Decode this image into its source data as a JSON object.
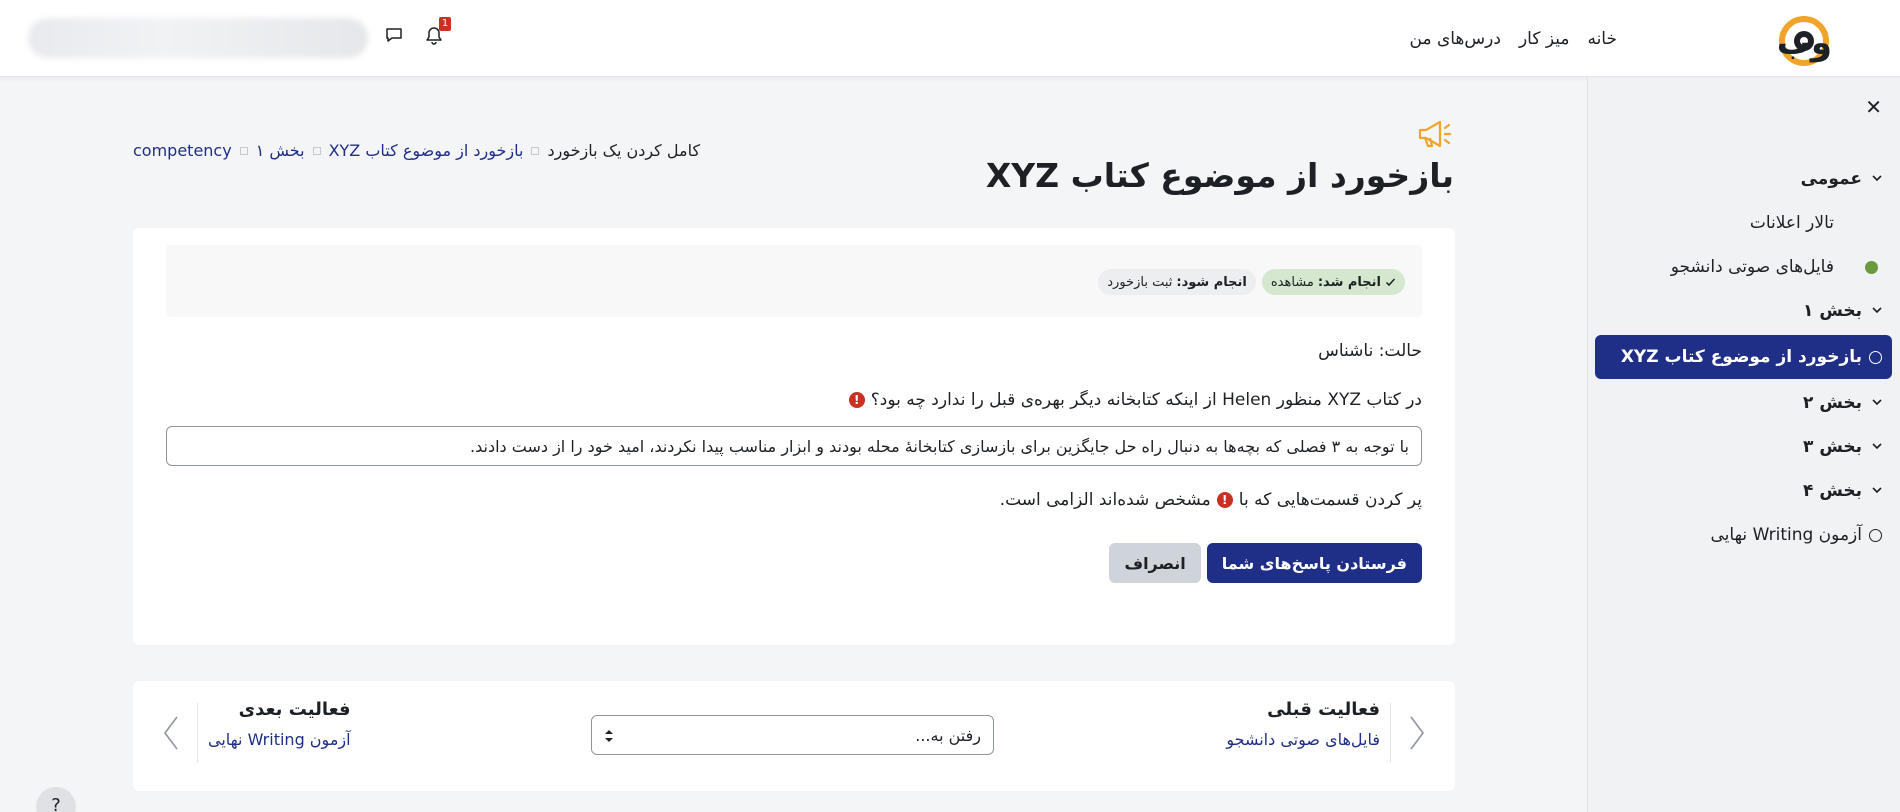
{
  "navbar": {
    "logo_text": "وب",
    "links": [
      "خانه",
      "میز کار",
      "درس‌های من"
    ],
    "notification_count": "1"
  },
  "drawer": {
    "close_glyph": "✕",
    "course_index": [
      {
        "type": "section",
        "label": "عمومی"
      },
      {
        "type": "item",
        "label": "تالار اعلانات",
        "state": "none"
      },
      {
        "type": "item",
        "label": "فایل‌های صوتی دانشجو",
        "state": "done"
      },
      {
        "type": "section",
        "label": "بخش ۱"
      },
      {
        "type": "item",
        "label": "بازخورد از موضوع کتاب XYZ",
        "state": "active"
      },
      {
        "type": "section",
        "label": "بخش ۲"
      },
      {
        "type": "section",
        "label": "بخش ۳"
      },
      {
        "type": "section",
        "label": "بخش ۴"
      },
      {
        "type": "item",
        "label": "آزمون Writing نهایی",
        "state": "todo"
      }
    ]
  },
  "header": {
    "title": "بازخورد از موضوع کتاب XYZ",
    "icon": "megaphone-icon",
    "breadcrumb": [
      "competency",
      "بخش ۱",
      "بازخورد از موضوع کتاب XYZ",
      "کامل کردن یک بازخورد"
    ]
  },
  "completion": {
    "done_label": "انجام شد:",
    "done_value": "مشاهده",
    "todo_label": "انجام شود:",
    "todo_value": "ثبت بازخورد"
  },
  "form": {
    "status": "حالت: ناشناس",
    "question": "در کتاب XYZ منظور Helen از اینکه کتابخانه دیگر بهره‌ی قبل را ندارد چه بود؟",
    "answer": "با توجه به ۳ فصلی که بچه‌ها به دنبال راه حل جایگزین برای بازسازی کتابخانهٔ محله بودند و ابزار مناسب پیدا نکردند، امید خود را از دست دادند.",
    "required_before": "پر کردن قسمت‌هایی که با",
    "required_after": "مشخص شده‌اند الزامی است.",
    "submit_label": "فرستادن پاسخ‌های شما",
    "cancel_label": "انصراف"
  },
  "activity_nav": {
    "prev_heading": "فعالیت قبلی",
    "prev_link": "فایل‌های صوتی دانشجو",
    "jump_placeholder": "رفتن به...",
    "next_heading": "فعالیت بعدی",
    "next_link": "آزمون Writing نهایی"
  },
  "colors": {
    "primary": "#1f2f88",
    "accent_orange": "#f0a52a",
    "error_red": "#ca3120",
    "success_green": "#6a9a3d"
  },
  "help_glyph": "?"
}
